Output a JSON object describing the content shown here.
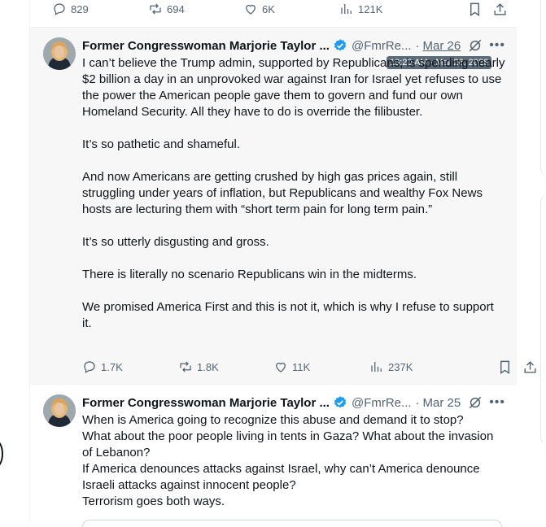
{
  "top_actions": {
    "replies": "829",
    "reposts": "694",
    "likes": "6K",
    "views": "121K"
  },
  "tweets": [
    {
      "name": "Former Congresswoman Marjorie Taylor ...",
      "handle": "@FmrRe...",
      "sep": "·",
      "date": "Mar 26",
      "tooltip": "10:20 AM · Mar 26, 2026",
      "text": "I can’t believe the Trump admin, supported by Republicans, is spending nearly $2 billion a day in an unprovoked war against Iran for Israel yet refuses to use the power the American people gave them to govern and fund our own Homeland Security. All they have to do is override the filibuster.\n\nIt’s so pathetic and shameful.\n\nAnd now Americans are getting crushed by high gas prices again, still struggling under years of inflation, but Republicans and wealthy Fox News hosts are lecturing them with “short term pain for long term pain.”\n\nIt’s so utterly disgusting and gross.\n\nThere is literally no scenario Republicans win in the midterms.\n\nWe promised America First and this is not it, which is why I refuse to support it.",
      "replies": "1.7K",
      "reposts": "1.8K",
      "likes": "11K",
      "views": "237K"
    },
    {
      "name": "Former Congresswoman Marjorie Taylor ...",
      "handle": "@FmrRe...",
      "sep": "·",
      "date": "Mar 25",
      "text": "When is America going to recognize this abuse and demand it to stop?\nWhat about the poor people living in tents in Gaza? What about the invasion of Lebanon?\nIf America denounces attacks against Israel, why can’t America denounce Israeli attacks against innocent people?\nTerrorism goes both ways."
    }
  ],
  "icons": {
    "verified_color": "#1d9bf0",
    "text_color": "#0f1419",
    "muted_color": "#536471"
  }
}
